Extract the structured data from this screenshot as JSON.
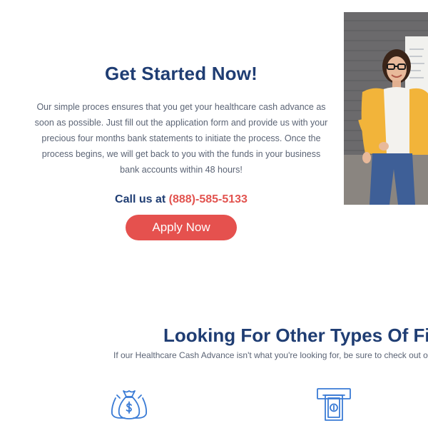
{
  "hero": {
    "title": "Get Started Now!",
    "description": "Our simple proces ensures that you get your healthcare cash advance as soon as possible. Just fill out the application form and provide us with your precious four months bank statements to initiate the process. Once the process begins, we will get back to you with the funds in your business bank accounts within 48 hours!",
    "call_prefix": "Call us at",
    "phone": "(888)-585-5133",
    "apply_label": "Apply Now"
  },
  "other_types": {
    "title": "Looking For Other Types Of Fi",
    "subtitle": "If our Healthcare Cash Advance isn't what you're looking for, be sure to check out our"
  },
  "icons": {
    "money_bags": "money-bags-icon",
    "atm_cash": "atm-cash-icon"
  },
  "colors": {
    "heading": "#1f3d73",
    "body_text": "#5b6475",
    "accent": "#e5514e",
    "icon_blue": "#3a7bd5"
  }
}
